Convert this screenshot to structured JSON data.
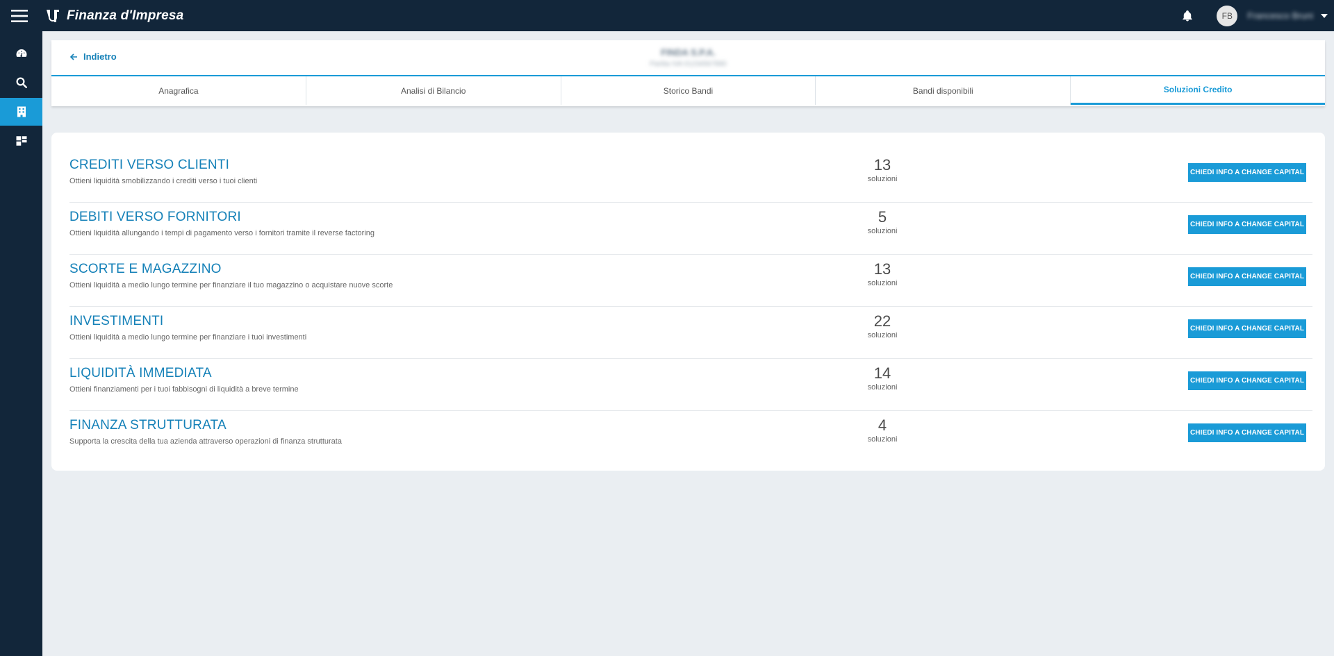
{
  "app": {
    "title": "Finanza d'Impresa"
  },
  "user": {
    "initials": "FB",
    "name": "Francesco Bruni"
  },
  "nav": {
    "back_label": "Indietro",
    "company_name": "FINDA S.P.A.",
    "company_sub": "Partita IVA 01234567890"
  },
  "tabs": [
    {
      "label": "Anagrafica"
    },
    {
      "label": "Analisi di Bilancio"
    },
    {
      "label": "Storico Bandi"
    },
    {
      "label": "Bandi disponibili"
    },
    {
      "label": "Soluzioni Credito"
    }
  ],
  "active_tab": "Soluzioni Credito",
  "solutions": [
    {
      "title": "CREDITI VERSO CLIENTI",
      "description": "Ottieni liquidità smobilizzando i crediti verso i tuoi clienti",
      "count": "13",
      "count_label": "soluzioni",
      "button": "CHIEDI INFO A CHANGE CAPITAL"
    },
    {
      "title": "DEBITI VERSO FORNITORI",
      "description": "Ottieni liquidità allungando i tempi di pagamento verso i fornitori tramite il reverse factoring",
      "count": "5",
      "count_label": "soluzioni",
      "button": "CHIEDI INFO A CHANGE CAPITAL"
    },
    {
      "title": "SCORTE E MAGAZZINO",
      "description": "Ottieni liquidità a medio lungo termine per finanziare il tuo magazzino o acquistare nuove scorte",
      "count": "13",
      "count_label": "soluzioni",
      "button": "CHIEDI INFO A CHANGE CAPITAL"
    },
    {
      "title": "INVESTIMENTI",
      "description": "Ottieni liquidità a medio lungo termine per finanziare i tuoi investimenti",
      "count": "22",
      "count_label": "soluzioni",
      "button": "CHIEDI INFO A CHANGE CAPITAL"
    },
    {
      "title": "LIQUIDITÀ IMMEDIATA",
      "description": "Ottieni finanziamenti per i tuoi fabbisogni di liquidità a breve termine",
      "count": "14",
      "count_label": "soluzioni",
      "button": "CHIEDI INFO A CHANGE CAPITAL"
    },
    {
      "title": "FINANZA STRUTTURATA",
      "description": "Supporta la crescita della tua azienda attraverso operazioni di finanza strutturata",
      "count": "4",
      "count_label": "soluzioni",
      "button": "CHIEDI INFO A CHANGE CAPITAL"
    }
  ],
  "icons": {
    "menu": "hamburger-icon",
    "logo": "brand-logo-icon",
    "bell": "bell-icon",
    "caret": "caret-down-icon",
    "back": "arrow-left-icon",
    "sidebar": [
      "dashboard-icon",
      "search-icon",
      "building-icon",
      "grid-icon"
    ]
  },
  "colors": {
    "topbar": "#12263a",
    "accent": "#1a9bd7",
    "title": "#1581b8",
    "background": "#eaeef2"
  }
}
